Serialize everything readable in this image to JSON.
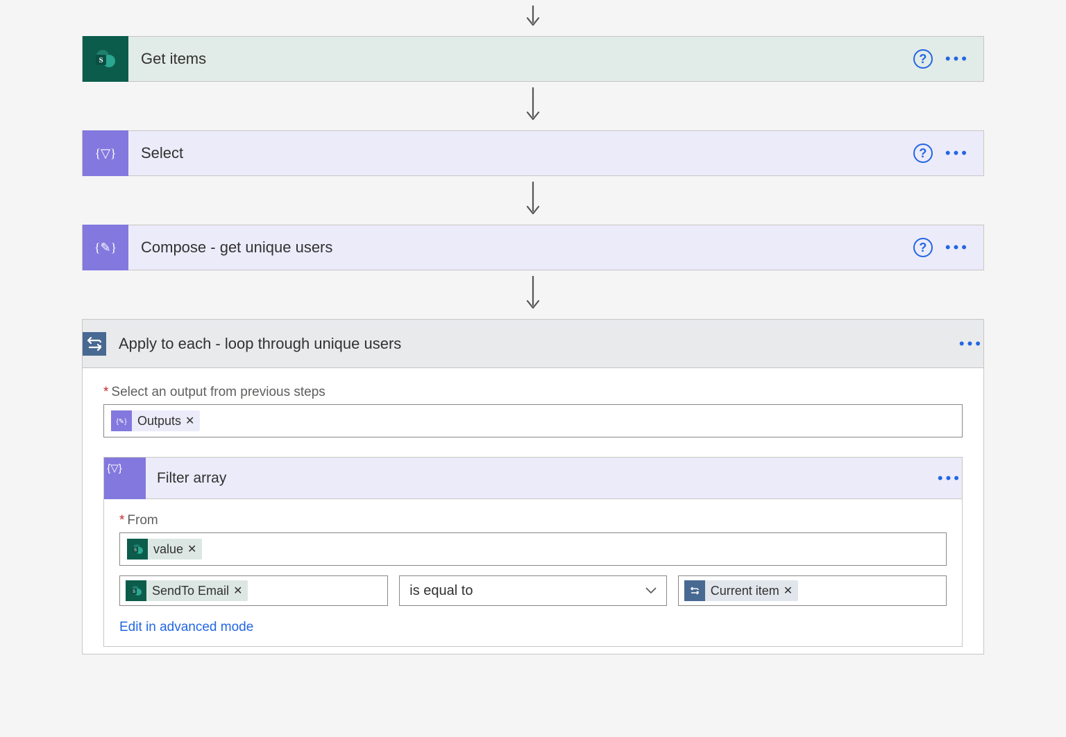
{
  "steps": {
    "get_items": {
      "title": "Get items"
    },
    "select": {
      "title": "Select"
    },
    "compose": {
      "title": "Compose - get unique users"
    },
    "apply_each": {
      "title": "Apply to each - loop through unique users"
    },
    "filter_array": {
      "title": "Filter array"
    }
  },
  "apply_each": {
    "field_label": "Select an output from previous steps",
    "token": {
      "label": "Outputs"
    }
  },
  "filter_array": {
    "from_label": "From",
    "from_token": {
      "label": "value"
    },
    "left_token": {
      "label": "SendTo Email"
    },
    "operator": "is equal to",
    "right_token": {
      "label": "Current item"
    },
    "advanced_link": "Edit in advanced mode"
  }
}
